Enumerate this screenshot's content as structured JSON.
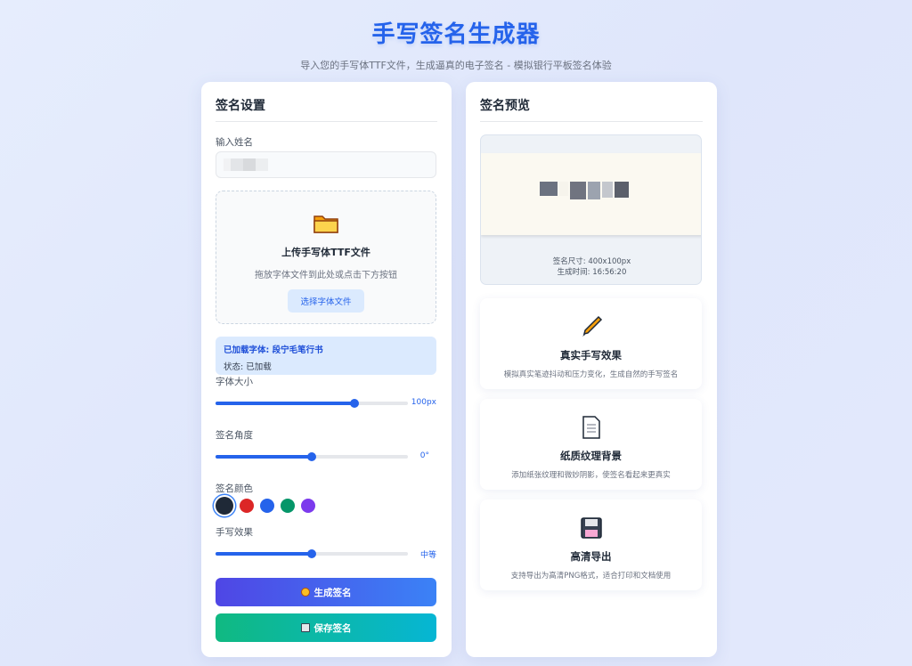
{
  "header": {
    "title": "手写签名生成器",
    "subtitle": "导入您的手写体TTF文件，生成逼真的电子签名 - 模拟银行平板签名体验"
  },
  "settings": {
    "title": "签名设置",
    "name_label": "输入姓名",
    "upload": {
      "icon": "folder-icon",
      "title": "上传手写体TTF文件",
      "hint": "拖放字体文件到此处或点击下方按钮",
      "button": "选择字体文件"
    },
    "font_info": {
      "loaded": "已加载字体: 段宁毛笔行书",
      "status": "状态: 已加载"
    },
    "font_size": {
      "label": "字体大小",
      "value_text": "100px",
      "level": 0.72
    },
    "angle": {
      "label": "签名角度",
      "value_text": "0°",
      "level": 0.5
    },
    "color": {
      "label": "签名颜色",
      "options": [
        "#1f2937",
        "#dc2626",
        "#2563eb",
        "#059669",
        "#7c3aed"
      ],
      "selected": 0
    },
    "effect": {
      "label": "手写效果",
      "value_text": "中等",
      "level": 0.5
    },
    "generate_button": "生成签名",
    "generate_icon": "brain-icon",
    "save_button": "保存签名",
    "save_icon": "floppy-icon"
  },
  "preview": {
    "title": "签名预览",
    "size_text": "签名尺寸: 400x100px",
    "time_text": "生成时间: 16:56:20"
  },
  "features": [
    {
      "icon": "pen-icon",
      "title": "真实手写效果",
      "desc": "模拟真实笔迹抖动和压力变化，生成自然的手写签名"
    },
    {
      "icon": "document-icon",
      "title": "纸质纹理背景",
      "desc": "添加纸张纹理和微妙阴影，使签名看起来更真实"
    },
    {
      "icon": "floppy-icon",
      "title": "高清导出",
      "desc": "支持导出为高清PNG格式，适合打印和文档使用"
    }
  ]
}
